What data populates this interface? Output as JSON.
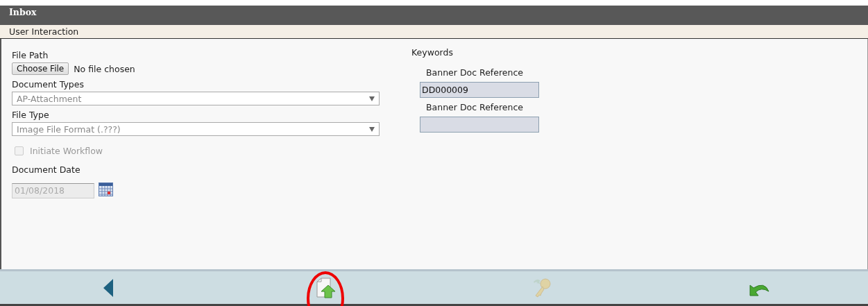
{
  "window": {
    "title": "Inbox"
  },
  "section": {
    "title": "User Interaction"
  },
  "form": {
    "file_path": {
      "label": "File Path",
      "button": "Choose File",
      "status": "No file chosen"
    },
    "document_types": {
      "label": "Document Types",
      "value": "AP-Attachment"
    },
    "file_type": {
      "label": "File Type",
      "value": "Image File Format (.???)"
    },
    "initiate_workflow": {
      "label": "Initiate Workflow",
      "checked": false,
      "disabled": true
    },
    "document_date": {
      "label": "Document Date",
      "value": "01/08/2018"
    }
  },
  "keywords": {
    "title": "Keywords",
    "fields": [
      {
        "label": "Banner Doc Reference",
        "value": "DD000009"
      },
      {
        "label": "Banner Doc Reference"
      }
    ]
  },
  "toolbar": {
    "buttons": [
      {
        "kind": "back",
        "disabled": false,
        "highlighted": false
      },
      {
        "kind": "upload",
        "disabled": false,
        "highlighted": true
      },
      {
        "kind": "key",
        "disabled": true,
        "highlighted": false
      },
      {
        "kind": "undo",
        "disabled": false,
        "highlighted": false
      }
    ]
  }
}
